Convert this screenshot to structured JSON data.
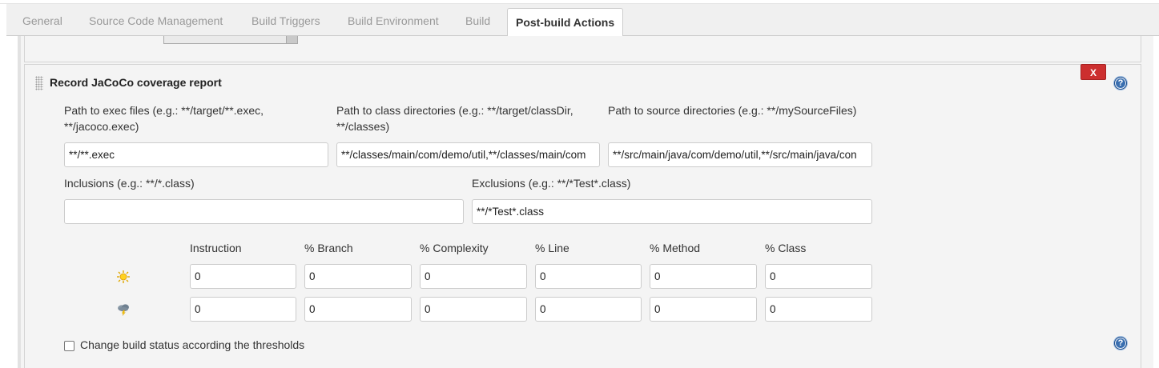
{
  "tabs": [
    {
      "label": "General"
    },
    {
      "label": "Source Code Management"
    },
    {
      "label": "Build Triggers"
    },
    {
      "label": "Build Environment"
    },
    {
      "label": "Build"
    },
    {
      "label": "Post-build Actions"
    }
  ],
  "active_tab": "Post-build Actions",
  "section": {
    "title": "Record JaCoCo coverage report",
    "delete_label": "X",
    "help_icon": "?"
  },
  "fields": {
    "exec_label_1": "Path to exec files (e.g.: **/target/**.exec,",
    "exec_label_2": "**/jacoco.exec)",
    "exec_value": "**/**.exec",
    "class_label_1": "Path to class directories (e.g.: **/target/classDir,",
    "class_label_2": "**/classes)",
    "class_value": "**/classes/main/com/demo/util,**/classes/main/com",
    "source_label": "Path to source directories (e.g.: **/mySourceFiles)",
    "source_value": "**/src/main/java/com/demo/util,**/src/main/java/con",
    "inclusions_label": "Inclusions (e.g.: **/*.class)",
    "inclusions_value": "",
    "exclusions_label": "Exclusions (e.g.: **/*Test*.class)",
    "exclusions_value": "**/*Test*.class"
  },
  "thresholds": {
    "headers": [
      "Instruction",
      "% Branch",
      "% Complexity",
      "% Line",
      "% Method",
      "% Class"
    ],
    "rows": [
      {
        "icon": "sunny-weather-icon",
        "values": [
          "0",
          "0",
          "0",
          "0",
          "0",
          "0"
        ]
      },
      {
        "icon": "stormy-weather-icon",
        "values": [
          "0",
          "0",
          "0",
          "0",
          "0",
          "0"
        ]
      }
    ]
  },
  "change_status": {
    "label": "Change build status according the thresholds",
    "checked": false
  },
  "colors": {
    "delete_red": "#cc2f2f",
    "help_blue": "#3a6fb0"
  }
}
